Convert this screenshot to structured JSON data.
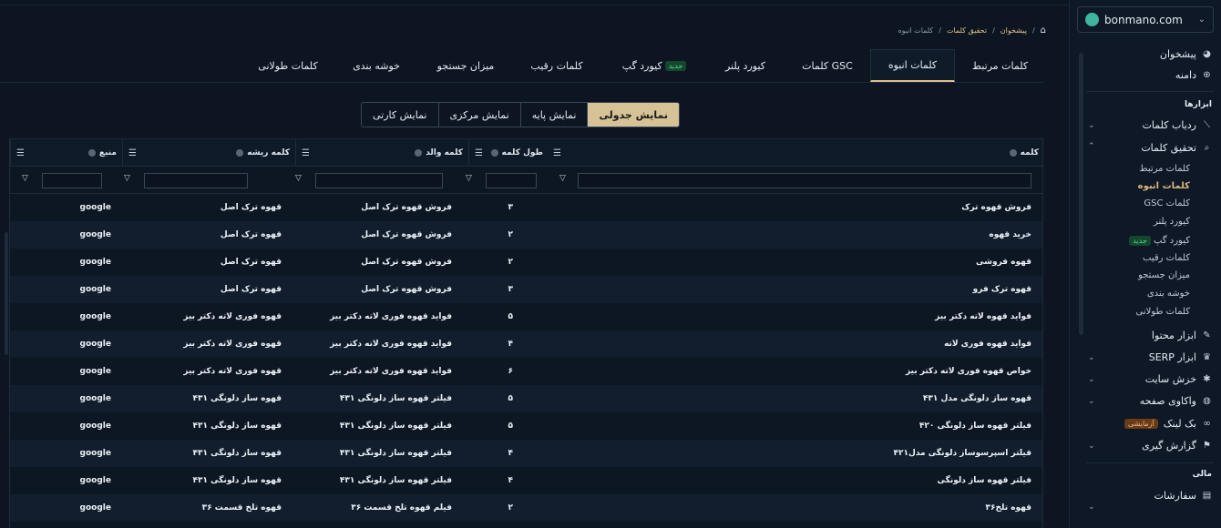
{
  "breadcrumb": {
    "home": "پیشخوان",
    "parent": "تحقیق کلمات",
    "current": "کلمات انبوه"
  },
  "tabs": [
    "کلمات مرتبط",
    "کلمات انبوه",
    "کلمات GSC",
    "کیورد پلنر",
    "کیورد گپ",
    "کلمات رقیب",
    "میزان جستجو",
    "خوشه بندی",
    "کلمات طولانی"
  ],
  "tab_badge": "جدید",
  "views": [
    "نمایش جدولی",
    "نمایش پایه",
    "نمایش مرکزی",
    "نمایش کارتی"
  ],
  "columns": {
    "keyword": "کلمه",
    "length": "طول کلمه",
    "parent": "کلمه والد",
    "root": "کلمه ریشه",
    "source": "منبع"
  },
  "rows": [
    {
      "keyword": "فروش قهوه ترک",
      "length": "۳",
      "parent": "فروش قهوه ترک اصل",
      "root": "قهوه ترک اصل",
      "source": "google"
    },
    {
      "keyword": "خرید قهوه",
      "length": "۲",
      "parent": "فروش قهوه ترک اصل",
      "root": "قهوه ترک اصل",
      "source": "google"
    },
    {
      "keyword": "قهوه فروشی",
      "length": "۲",
      "parent": "فروش قهوه ترک اصل",
      "root": "قهوه ترک اصل",
      "source": "google"
    },
    {
      "keyword": "قهوه ترک فرو",
      "length": "۳",
      "parent": "فروش قهوه ترک اصل",
      "root": "قهوه ترک اصل",
      "source": "google"
    },
    {
      "keyword": "فواید قهوه لاته دکتر بیز",
      "length": "۵",
      "parent": "فواید قهوه فوری لاته دکتر بیز",
      "root": "قهوه فوری لاته دکتر بیز",
      "source": "google"
    },
    {
      "keyword": "فواید قهوه فوری لاته",
      "length": "۴",
      "parent": "فواید قهوه فوری لاته دکتر بیز",
      "root": "قهوه فوری لاته دکتر بیز",
      "source": "google"
    },
    {
      "keyword": "خواص قهوه فوری لاته دکتر بیز",
      "length": "۶",
      "parent": "فواید قهوه فوری لاته دکتر بیز",
      "root": "قهوه فوری لاته دکتر بیز",
      "source": "google"
    },
    {
      "keyword": "قهوه ساز دلونگی مدل ۴۳۱",
      "length": "۵",
      "parent": "فیلتر قهوه ساز دلونگی ۴۳۱",
      "root": "قهوه ساز دلونگی ۴۳۱",
      "source": "google"
    },
    {
      "keyword": "فیلتر قهوه ساز دلونگی ۴۲۰",
      "length": "۵",
      "parent": "فیلتر قهوه ساز دلونگی ۴۳۱",
      "root": "قهوه ساز دلونگی ۴۳۱",
      "source": "google"
    },
    {
      "keyword": "فیلتر اسپرسوساز دلونگی مدل۴۲۱",
      "length": "۴",
      "parent": "فیلتر قهوه ساز دلونگی ۴۳۱",
      "root": "قهوه ساز دلونگی ۴۳۱",
      "source": "google"
    },
    {
      "keyword": "فیلتر قهوه ساز دلونگی",
      "length": "۴",
      "parent": "فیلتر قهوه ساز دلونگی ۴۳۱",
      "root": "قهوه ساز دلونگی ۴۳۱",
      "source": "google"
    },
    {
      "keyword": "قهوه تلخ۳۶",
      "length": "۲",
      "parent": "فیلم قهوه تلخ قسمت ۳۶",
      "root": "قهوه تلخ قسمت ۳۶",
      "source": "google"
    }
  ],
  "sidebar": {
    "domain": "bonmano.com",
    "dashboard": "پیشخوان",
    "domain_item": "دامنه",
    "tools_head": "ابزارها",
    "rank_tracker": "ردیاب کلمات",
    "research": "تحقیق کلمات",
    "sub": [
      "کلمات مرتبط",
      "کلمات انبوه",
      "کلمات GSC",
      "کیورد پلنر",
      "کیورد گپ",
      "کلمات رقیب",
      "میزان جستجو",
      "خوشه بندی",
      "کلمات طولانی"
    ],
    "sub_badge": "جدید",
    "content_tools": "ابزار محتوا",
    "serp_tools": "ابزار SERP",
    "crawl": "خزش سایت",
    "page_audit": "واکاوی صفحه",
    "backlink": "بک لینک",
    "backlink_badge": "آزمایشی",
    "reports": "گزارش گیری",
    "finance_head": "مالی",
    "orders": "سفارشات"
  }
}
